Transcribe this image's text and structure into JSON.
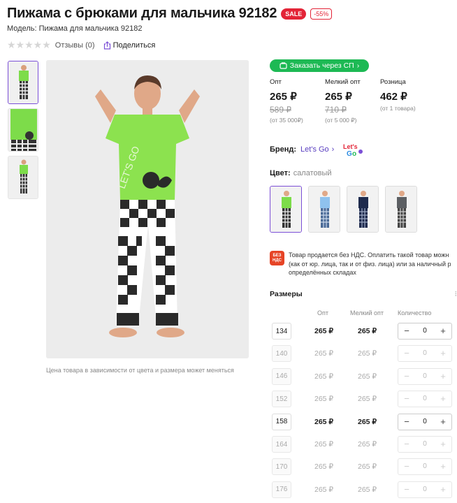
{
  "product": {
    "title": "Пижама с брюками для мальчика 92182",
    "sale_badge": "SALE",
    "discount_badge": "-55%",
    "model": "Модель: Пижама для мальчика 92182",
    "reviews": "Отзывы (0)",
    "share": "Поделиться",
    "rating_stars": 0
  },
  "gallery": {
    "caption": "Цена товара в зависимости от цвета и размера может меняться",
    "thumbs": [
      {
        "name": "thumb-front",
        "active": true
      },
      {
        "name": "thumb-detail",
        "active": false
      },
      {
        "name": "thumb-full",
        "active": false
      }
    ]
  },
  "order_button": "Заказать через СП",
  "prices": [
    {
      "label": "Опт",
      "price": "265 ₽",
      "old": "589 ₽",
      "cond": "(от 35 000₽)"
    },
    {
      "label": "Мелкий опт",
      "price": "265 ₽",
      "old": "710 ₽",
      "cond": "(от 5 000 ₽)"
    },
    {
      "label": "Розница",
      "price": "462 ₽",
      "old": "",
      "cond": "(от 1 товара)"
    }
  ],
  "brand": {
    "label": "Бренд:",
    "name": "Let's Go",
    "logo": "Let's Go"
  },
  "color": {
    "label": "Цвет:",
    "value": "салатовый"
  },
  "swatches": [
    {
      "shirt": "#7ddc4a",
      "active": true
    },
    {
      "shirt": "#8fc2ee",
      "active": false
    },
    {
      "shirt": "#1f2b4d",
      "active": false
    },
    {
      "shirt": "#5c5f63",
      "active": false
    }
  ],
  "vat": {
    "icon_text": "БЕЗ НДС",
    "lines": [
      "Товар продается без НДС. Оплатить такой товар можн",
      "(как от юр. лица, так и от физ. лица) или за наличный р",
      "определённых складах"
    ]
  },
  "sizes": {
    "title": "Размеры",
    "columns": [
      "Опт",
      "Мелкий опт",
      "Количество"
    ],
    "rows": [
      {
        "size": "134",
        "opt": "265 ₽",
        "small": "265 ₽",
        "qty": "0",
        "available": true
      },
      {
        "size": "140",
        "opt": "265 ₽",
        "small": "265 ₽",
        "qty": "0",
        "available": false
      },
      {
        "size": "146",
        "opt": "265 ₽",
        "small": "265 ₽",
        "qty": "0",
        "available": false
      },
      {
        "size": "152",
        "opt": "265 ₽",
        "small": "265 ₽",
        "qty": "0",
        "available": false
      },
      {
        "size": "158",
        "opt": "265 ₽",
        "small": "265 ₽",
        "qty": "0",
        "available": true
      },
      {
        "size": "164",
        "opt": "265 ₽",
        "small": "265 ₽",
        "qty": "0",
        "available": false
      },
      {
        "size": "170",
        "opt": "265 ₽",
        "small": "265 ₽",
        "qty": "0",
        "available": false
      },
      {
        "size": "176",
        "opt": "265 ₽",
        "small": "265 ₽",
        "qty": "0",
        "available": false
      }
    ]
  },
  "colors": {
    "accent": "#7b4fd6",
    "sale": "#e32437",
    "green": "#1db954",
    "shirt": "#7ddc4a"
  }
}
